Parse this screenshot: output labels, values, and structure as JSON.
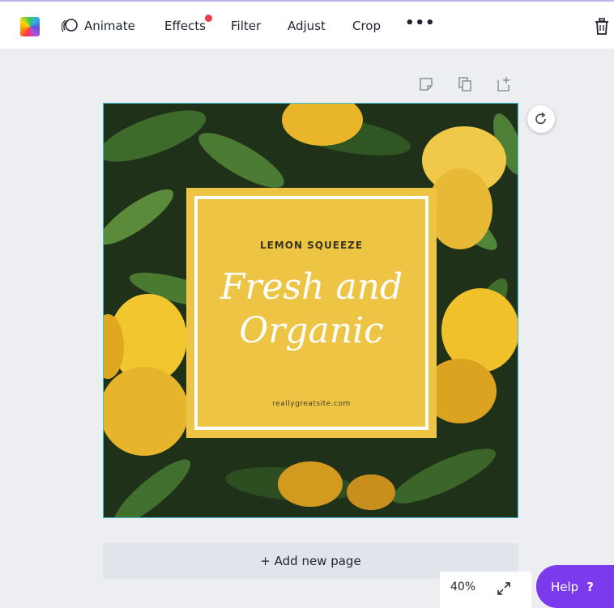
{
  "toolbar": {
    "animate": "Animate",
    "effects": "Effects",
    "filter": "Filter",
    "adjust": "Adjust",
    "crop": "Crop",
    "more": "•••"
  },
  "design": {
    "kicker": "LEMON SQUEEZE",
    "title_line1": "Fresh and",
    "title_line2": "Organic",
    "url": "reallygreatsite.com",
    "card_color": "#edc443",
    "border_accent": "#3fbfcf"
  },
  "add_page": "+ Add new page",
  "zoom": "40%",
  "help": {
    "label": "Help",
    "icon": "?"
  },
  "colors": {
    "help_bg": "#7c3aed",
    "canvas_bg": "#eceef2",
    "notification_dot": "#ef3b4a"
  },
  "icons": [
    "color-swatch-icon",
    "animate-icon",
    "more-icon",
    "trash-icon",
    "notes-icon",
    "duplicate-icon",
    "add-page-icon",
    "rotate-icon",
    "fullscreen-icon"
  ]
}
